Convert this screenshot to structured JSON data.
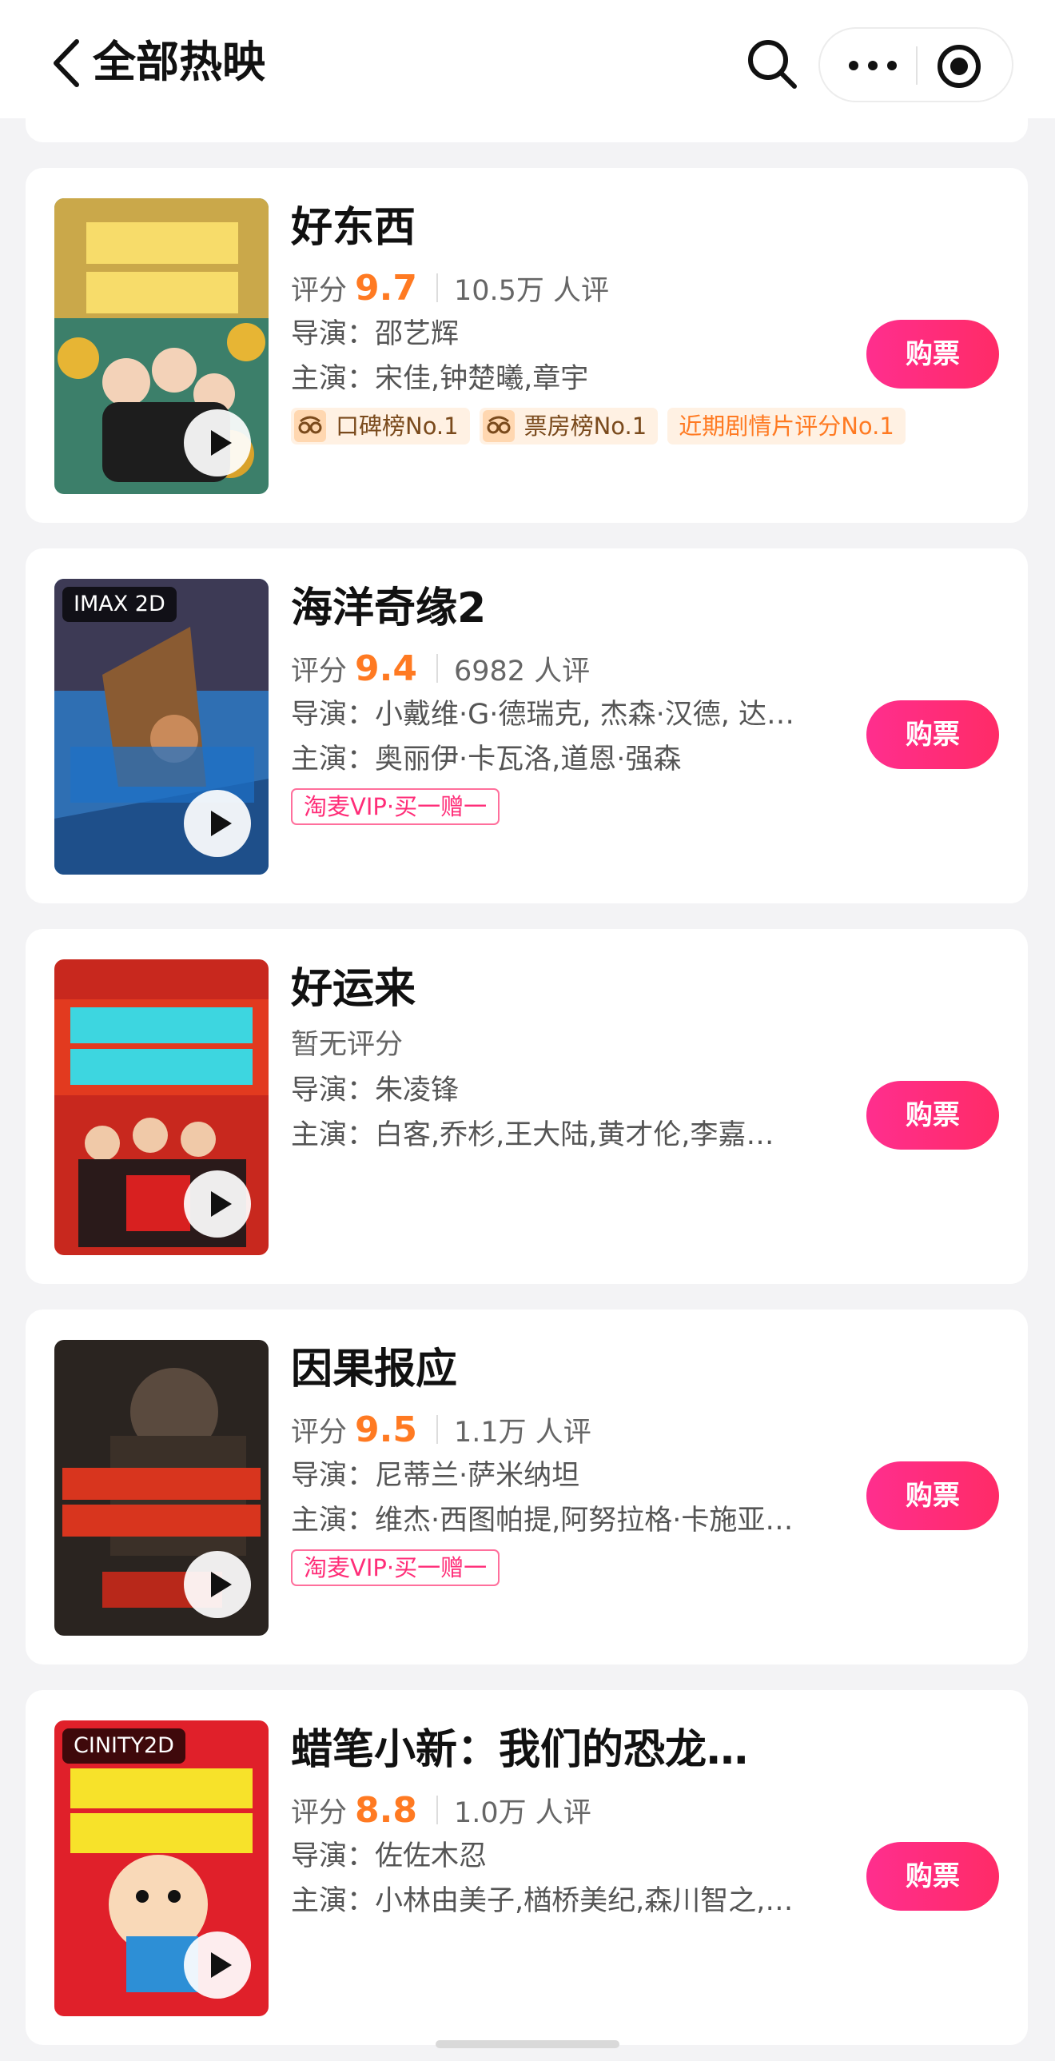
{
  "header": {
    "title": "全部热映",
    "icons": {
      "back": "chevron-left-icon",
      "search": "search-icon",
      "more": "more-dots-icon",
      "target": "target-icon"
    }
  },
  "colors": {
    "accent": "#ff2e8e",
    "score": "#ff7a22",
    "background": "#f3f3f5"
  },
  "movies": [
    {
      "title": "好东西",
      "rating_label": "评分",
      "score": "9.7",
      "count": "10.5万 人评",
      "director": "导演：邵艺辉",
      "cast": "主演：宋佳,钟楚曦,章宇",
      "tags": [
        "口碑榜No.1",
        "票房榜No.1",
        "近期剧情片评分No.1"
      ],
      "buy": "购票"
    },
    {
      "title": "海洋奇缘2",
      "badge": "IMAX 2D",
      "rating_label": "评分",
      "score": "9.4",
      "count": "6982 人评",
      "director": "导演：小戴维·G·德瑞克, 杰森·汉德, 达…",
      "cast": "主演：奥丽伊·卡瓦洛,道恩·强森",
      "tags": [
        "淘麦VIP·买一赠一"
      ],
      "buy": "购票"
    },
    {
      "title": "好运来",
      "no_rating": "暂无评分",
      "director": "导演：朱凌锋",
      "cast": "主演：白客,乔杉,王大陆,黄才伦,李嘉…",
      "buy": "购票"
    },
    {
      "title": "因果报应",
      "rating_label": "评分",
      "score": "9.5",
      "count": "1.1万 人评",
      "director": "导演：尼蒂兰·萨米纳坦",
      "cast": "主演：维杰·西图帕提,阿努拉格·卡施亚…",
      "tags": [
        "淘麦VIP·买一赠一"
      ],
      "buy": "购票"
    },
    {
      "title": "蜡笔小新：我们的恐龙…",
      "badge": "CINITY2D",
      "rating_label": "评分",
      "score": "8.8",
      "count": "1.0万 人评",
      "director": "导演：佐佐木忍",
      "cast": "主演：小林由美子,楢桥美纪,森川智之,…",
      "buy": "购票"
    }
  ]
}
